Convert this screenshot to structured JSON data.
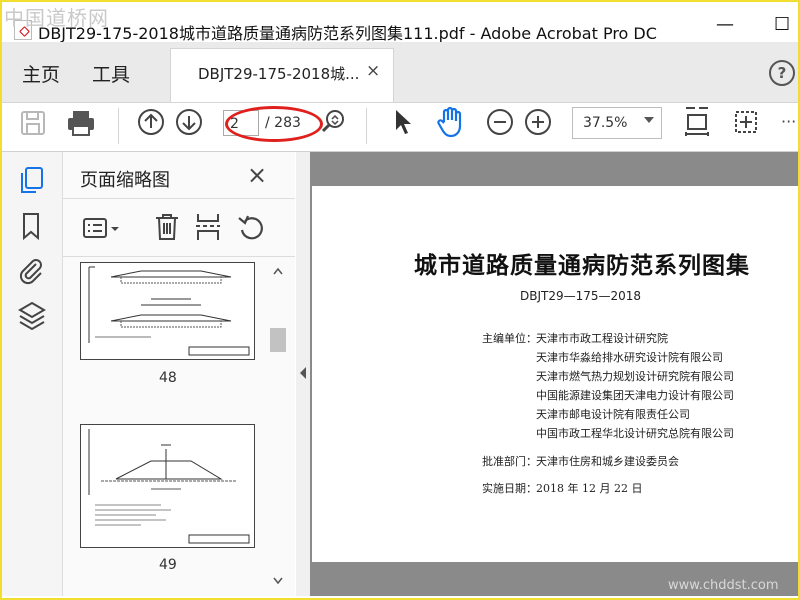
{
  "window": {
    "watermark": "中国道桥网",
    "title": "DBJT29-175-2018城市道路质量通病防范系列图集111.pdf - Adobe Acrobat Pro DC",
    "minimize": "—",
    "maximize": "☐"
  },
  "menu": {
    "home": "主页",
    "tools": "工具",
    "tab_label": "DBJT29-175-2018城...",
    "tab_close": "×",
    "help": "?"
  },
  "toolbar": {
    "current_page": "2",
    "total_pages": "/ 283",
    "zoom": "37.5%",
    "more": "···"
  },
  "panel": {
    "title": "页面缩略图",
    "close": "×",
    "thumbnails": [
      {
        "page": "48"
      },
      {
        "page": "49"
      }
    ]
  },
  "document": {
    "title": "城市道路质量通病防范系列图集",
    "code": "DBJT29—175—2018",
    "editor_label": "主编单位：",
    "editors": [
      "天津市市政工程设计研究院",
      "天津市华淼给排水研究设计院有限公司",
      "天津市燃气热力规划设计研究院有限公司",
      "中国能源建设集团天津电力设计有限公司",
      "天津市邮电设计院有限责任公司",
      "中国市政工程华北设计研究总院有限公司"
    ],
    "approval_label": "批准部门：",
    "approval": "天津市住房和城乡建设委员会",
    "date_label": "实施日期：",
    "date": "2018 年 12 月 22 日"
  },
  "footer_watermark": "www.chddst.com",
  "colors": {
    "accent_blue": "#1473e6",
    "annotation_red": "#e0201c",
    "frame_yellow": "#f2de2e"
  }
}
